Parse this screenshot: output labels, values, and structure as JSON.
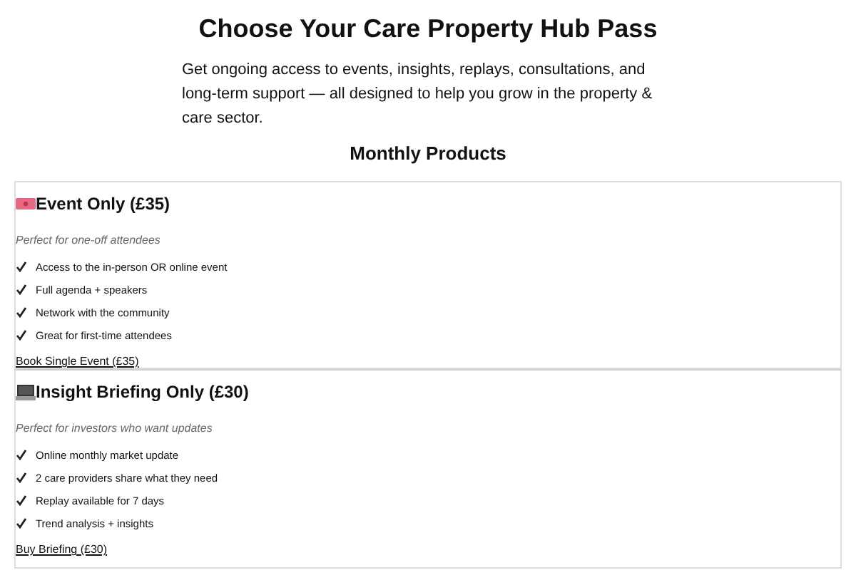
{
  "title": "Choose Your Care Property Hub Pass",
  "intro": "Get ongoing access to events, insights, replays, consultations, and long-term support — all designed to help you grow in the property & care sector.",
  "section_heading": "Monthly Products",
  "products": [
    {
      "kind": "event",
      "name": "Event Only (£35)",
      "tagline": "Perfect for one-off attendees",
      "features": [
        "Access to the in-person OR online event",
        "Full agenda + speakers",
        "Network with the community",
        "Great for first-time attendees"
      ],
      "link": "Book Single Event (£35)"
    },
    {
      "kind": "briefing",
      "name": "Insight Briefing Only (£30)",
      "tagline": "Perfect for investors who want updates",
      "features": [
        "Online monthly market update",
        "2 care providers share what they need",
        "Replay available for 7 days",
        "Trend analysis + insights"
      ],
      "link": "Buy Briefing (£30)"
    }
  ]
}
